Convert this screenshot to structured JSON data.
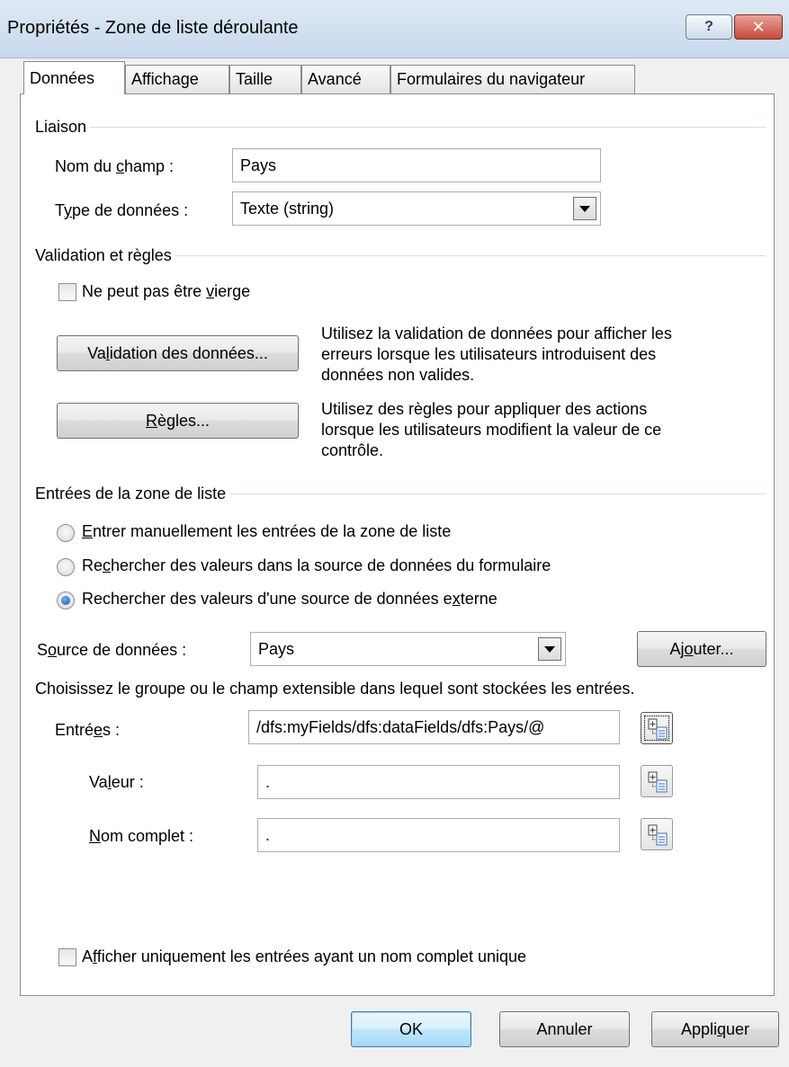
{
  "window": {
    "title": "Propriétés - Zone de liste déroulante",
    "help_glyph": "?",
    "close_glyph": "✕"
  },
  "tabs": [
    {
      "label": "Données"
    },
    {
      "label": "Affichage"
    },
    {
      "label": "Taille"
    },
    {
      "label": "Avancé"
    },
    {
      "label": "Formulaires du navigateur"
    }
  ],
  "liaison": {
    "section_title": "Liaison",
    "field_name_label_pre": "Nom du ",
    "field_name_label_u": "c",
    "field_name_label_post": "hamp :",
    "field_name_value": "Pays",
    "data_type_label_pre": "T",
    "data_type_label_u": "y",
    "data_type_label_post": "pe de données :",
    "data_type_value": "Texte (string)"
  },
  "validation": {
    "section_title": "Validation et règles",
    "cannot_be_blank_pre": "Ne peut pas être ",
    "cannot_be_blank_u": "v",
    "cannot_be_blank_post": "ierge",
    "data_validation_button_pre": "Va",
    "data_validation_button_u": "l",
    "data_validation_button_post": "idation des données...",
    "data_validation_desc": [
      "Utilisez la validation de données pour afficher les",
      "erreurs lorsque les utilisateurs introduisent des",
      "données non valides."
    ],
    "rules_button_u": "R",
    "rules_button_post": "ègles...",
    "rules_desc": [
      "Utilisez des règles pour appliquer des actions",
      "lorsque les utilisateurs modifient la valeur de ce",
      "contrôle."
    ]
  },
  "list_entries": {
    "section_title": "Entrées de la zone de liste",
    "radio_manual_u": "E",
    "radio_manual_post": "ntrer manuellement les entrées de la zone de liste",
    "radio_form_pre": "Re",
    "radio_form_u": "c",
    "radio_form_post": "hercher des valeurs dans la source de données du formulaire",
    "radio_external_pre": "Rechercher des valeurs d'une source de données e",
    "radio_external_u": "x",
    "radio_external_post": "terne",
    "selected_option": "external",
    "data_source_label_pre": "S",
    "data_source_label_u": "o",
    "data_source_label_post": "urce de données :",
    "data_source_value": "Pays",
    "add_button_pre": "Aj",
    "add_button_u": "o",
    "add_button_post": "uter...",
    "hint": "Choisissez le groupe ou le champ extensible dans lequel sont stockées les entrées.",
    "entries_label_pre": "Entré",
    "entries_label_u": "e",
    "entries_label_post": "s :",
    "entries_value": "/dfs:myFields/dfs:dataFields/dfs:Pays/@",
    "value_label_pre": "Va",
    "value_label_u": "l",
    "value_label_post": "eur :",
    "value_value": ".",
    "display_name_label_u": "N",
    "display_name_label_post": "om complet :",
    "display_name_value": ".",
    "unique_only_pre": "A",
    "unique_only_u": "f",
    "unique_only_post": "ficher uniquement les entrées ayant un nom complet unique"
  },
  "footer": {
    "ok": "OK",
    "cancel": "Annuler",
    "apply_pre": "Appli",
    "apply_u": "q",
    "apply_post": "uer"
  }
}
